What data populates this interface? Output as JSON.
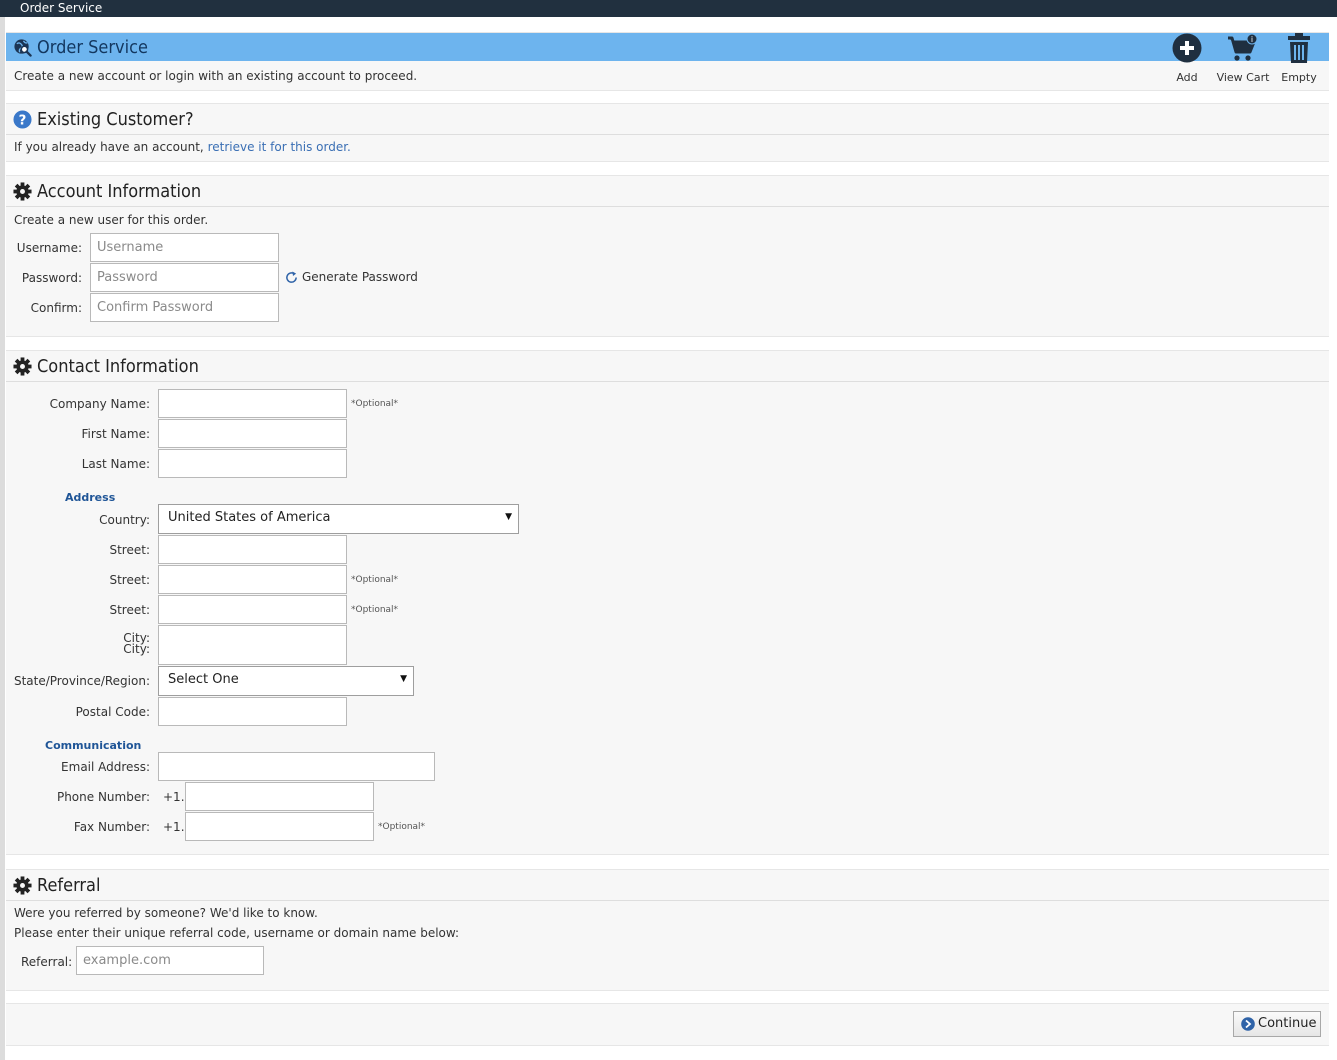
{
  "window": {
    "title": "Order Service"
  },
  "order": {
    "title": "Order Service",
    "subtitle": "Create a new account or login with an existing account to proceed.",
    "toolbar": {
      "add": "Add",
      "view_cart": "View Cart",
      "empty": "Empty"
    }
  },
  "existing": {
    "title": "Existing Customer?",
    "text_prefix": "If you already have an account,",
    "link": "retrieve it for this order."
  },
  "account": {
    "title": "Account Information",
    "subtitle": "Create a new user for this order.",
    "username_label": "Username:",
    "username_placeholder": "Username",
    "password_label": "Password:",
    "password_placeholder": "Password",
    "confirm_label": "Confirm:",
    "confirm_placeholder": "Confirm Password",
    "generate": "Generate Password"
  },
  "contact": {
    "title": "Contact Information",
    "optional": "*Optional*",
    "company_label": "Company Name:",
    "first_label": "First Name:",
    "last_label": "Last Name:",
    "address_heading": "Address",
    "country_label": "Country:",
    "country_value": "United States of America",
    "street_label": "Street:",
    "city_label": "City:",
    "state_label": "State/Province/Region:",
    "state_value": "Select One",
    "postal_label": "Postal Code:",
    "communication_heading": "Communication",
    "email_label": "Email Address:",
    "phone_label": "Phone Number:",
    "fax_label": "Fax Number:",
    "country_code": "+1."
  },
  "referral": {
    "title": "Referral",
    "line1": "Were you referred by someone? We'd like to know.",
    "line2": "Please enter their unique referral code, username or domain name below:",
    "label": "Referral:",
    "placeholder": "example.com"
  },
  "footer": {
    "continue": "Continue"
  },
  "colors": {
    "header_bar": "#21303f",
    "order_header": "#6db4ee",
    "link": "#3a6fb4",
    "group_heading": "#1f5597"
  }
}
